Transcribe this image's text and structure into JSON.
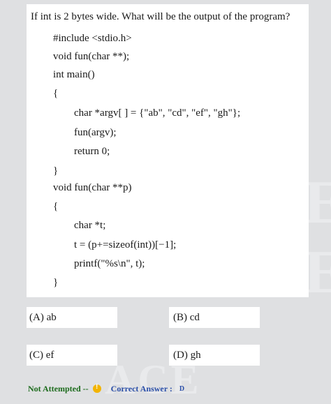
{
  "question": {
    "text": "If int is 2 bytes wide. What will be the output of the program?"
  },
  "code": {
    "lines": [
      "#include <stdio.h>",
      "void fun(char **);",
      "int main()",
      "{",
      "char *argv[ ] = {\"ab\", \"cd\", \"ef\", \"gh\"};",
      "fun(argv);",
      "return 0;",
      "}",
      "void fun(char **p)",
      "{",
      "char *t;",
      "t = (p+=sizeof(int))[−1];",
      "printf(\"%s\\n\", t);",
      "}"
    ]
  },
  "options": {
    "a": "(A) ab",
    "b": "(B) cd",
    "c": "(C) ef",
    "d": "(D) gh"
  },
  "status": {
    "attempt": "Not Attempted --",
    "correct_label": "Correct Answer :",
    "correct_value": "D",
    "icon": "warning-circle-icon",
    "colors": {
      "attempt": "#1c6b1c",
      "correct": "#2b4fa8",
      "icon": "#f2b400"
    }
  }
}
